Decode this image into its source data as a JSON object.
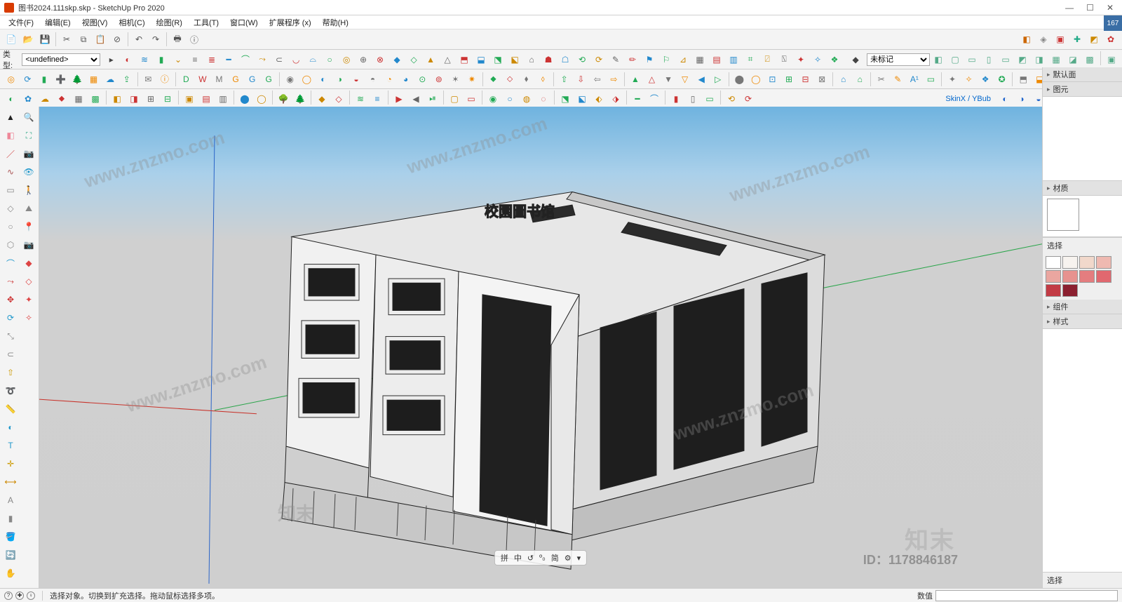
{
  "window": {
    "title": "图书2024.111skp.skp - SketchUp Pro 2020",
    "coord_badge": "167"
  },
  "menu": {
    "items": [
      "文件(F)",
      "编辑(E)",
      "视图(V)",
      "相机(C)",
      "绘图(R)",
      "工具(T)",
      "窗口(W)",
      "扩展程序 (x)",
      "帮助(H)"
    ]
  },
  "type_row": {
    "label": "类型:",
    "value": "<undefined>"
  },
  "tag_dropdown": {
    "value": "未标记"
  },
  "plugin_label": "SkinX / YBub",
  "right_tray": {
    "sections": [
      "默认面",
      "图元",
      "材质",
      "组件",
      "样式"
    ],
    "select_label": "选择",
    "bottom_select_label": "选择",
    "swatch_colors": [
      "#ffffff",
      "#f7f3ef",
      "#f1d8cb",
      "#efb9b1",
      "#eaa6a0",
      "#e7928f",
      "#e47d7f",
      "#e1686f",
      "#c23b45",
      "#8b2030"
    ]
  },
  "view_controls": {
    "items": [
      "拼",
      "中",
      "↺",
      "º₀",
      "简",
      "⚙",
      "▾"
    ]
  },
  "vcb": {
    "label": "数值",
    "value": ""
  },
  "status": {
    "hint": "选择对象。切换到扩充选择。拖动鼠标选择多项。"
  },
  "model": {
    "building_label": "校園圖书馆"
  },
  "watermarks": {
    "brand": "知末",
    "brand_en": "www.znzmo.com",
    "id": "ID：1178846187"
  },
  "left_tool_names": [
    "select-tool",
    "eraser-tool",
    "line-tool",
    "freehand-tool",
    "rectangle-tool",
    "rotated-rect-tool",
    "circle-tool",
    "polygon-tool",
    "arc-tool",
    "2pt-arc-tool",
    "move-tool",
    "rotate-tool",
    "scale-tool",
    "offset-tool",
    "pushpull-tool",
    "followme-tool",
    "tape-tool",
    "protractor-tool",
    "text-tool",
    "axes-tool",
    "dimension-tool",
    "3dtext-tool",
    "section-tool",
    "paint-tool",
    "orbit-tool",
    "pan-tool",
    "zoom-tool",
    "zoom-extents-tool",
    "position-camera-tool",
    "lookaround-tool",
    "walk-tool",
    "sandbox-tool",
    "add-location-tool",
    "photo-match-tool",
    "plugin-a",
    "plugin-b",
    "plugin-c",
    "plugin-d"
  ],
  "left_tool_colors": [
    "#222",
    "#e89",
    "#c33",
    "#a55",
    "#888",
    "#888",
    "#888",
    "#888",
    "#29c",
    "#c33",
    "#c33",
    "#29c",
    "#888",
    "#888",
    "#c90",
    "#888",
    "#888",
    "#29c",
    "#29c",
    "#c90",
    "#c80",
    "#888",
    "#888",
    "#c33",
    "#3a8",
    "#3a8",
    "#3a8",
    "#3a8",
    "#c33",
    "#29c",
    "#c80",
    "#888",
    "#d44",
    "#d44",
    "#d44",
    "#d44",
    "#d44",
    "#d44"
  ]
}
